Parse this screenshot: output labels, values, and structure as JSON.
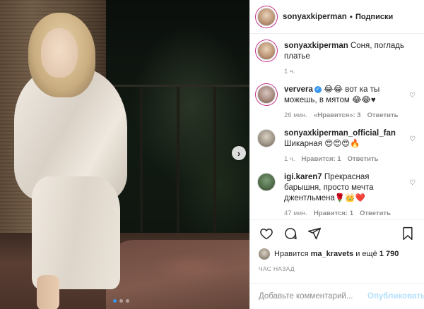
{
  "header": {
    "username": "sonyaxkiperman",
    "separator": "•",
    "follow_label": "Подписки"
  },
  "comments": [
    {
      "username": "sonyaxkiperman",
      "verified": false,
      "text": "Соня, погладь платье",
      "time": "1 ч.",
      "likes_label": "",
      "reply_label": ""
    },
    {
      "username": "ververa",
      "verified": true,
      "text": "😂😂 вот ка ты можешь, в мятом 😂😂♥",
      "time": "26 мин.",
      "likes_label": "«Нравится»: 3",
      "reply_label": "Ответить"
    },
    {
      "username": "sonyaxkiperman_official_fan",
      "verified": false,
      "text": "Шикарная 😍😍😍🔥",
      "time": "1 ч.",
      "likes_label": "Нравится: 1",
      "reply_label": "Ответить"
    },
    {
      "username": "igi.karen7",
      "verified": false,
      "text": "Прекрасная барышня, просто мечта джентльмена🌹👑❤️",
      "time": "47 мин.",
      "likes_label": "Нравится: 1",
      "reply_label": "Ответить"
    }
  ],
  "likes": {
    "prefix": "Нравится",
    "user": "ma_kravets",
    "and_more": "и ещё",
    "count": "1 790"
  },
  "timestamp": "ЧАС НАЗАД",
  "comment_box": {
    "placeholder": "Добавьте комментарий...",
    "publish_label": "Опубликовать"
  },
  "carousel": {
    "next_glyph": "›",
    "total_slides": 3,
    "active_slide": 1
  },
  "colors": {
    "accent": "#3897f0",
    "publish_disabled": "#b2dffc",
    "muted": "#8e8e8e"
  },
  "icons": [
    "heart-icon",
    "comment-icon",
    "share-icon",
    "bookmark-icon",
    "verified-icon",
    "chevron-right-icon"
  ]
}
